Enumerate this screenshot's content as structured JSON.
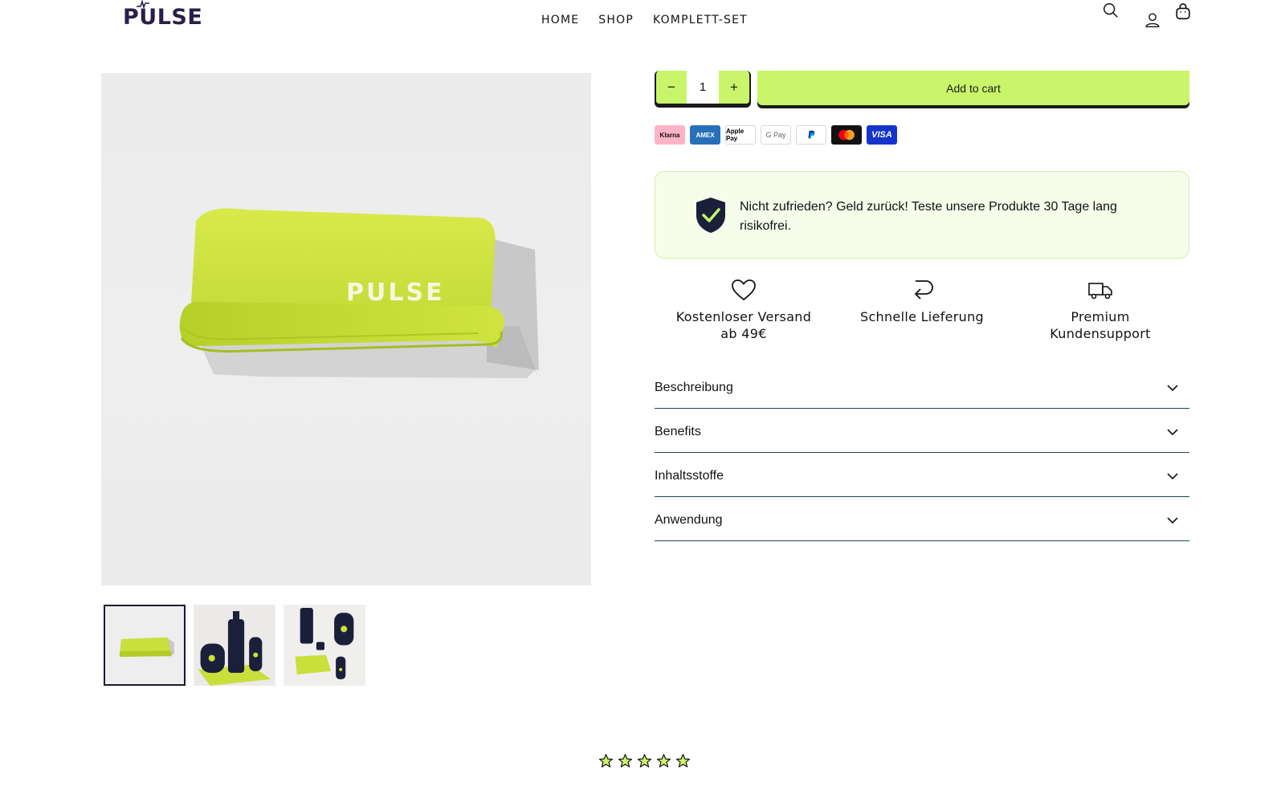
{
  "header": {
    "logo": "PULSE",
    "nav": [
      "HOME",
      "SHOP",
      "KOMPLETT-SET"
    ],
    "icons": [
      "search-icon",
      "account-icon",
      "cart-icon"
    ]
  },
  "product": {
    "image_brand_text": "PULSE",
    "thumbnails": [
      "band",
      "bottle-set",
      "full-set"
    ]
  },
  "buy": {
    "quantity": "1",
    "minus": "−",
    "plus": "+",
    "add_to_cart": "Add to cart"
  },
  "payments": [
    "Klarna",
    "AMEX",
    "Apple Pay",
    "G Pay",
    "PayPal",
    "Mastercard",
    "VISA"
  ],
  "guarantee": {
    "text": "Nicht zufrieden? Geld zurück! Teste unsere Produkte 30 Tage lang risikofrei."
  },
  "features": [
    {
      "icon": "heart-icon",
      "label": "Kostenloser Versand\nab 49€"
    },
    {
      "icon": "return-arrow-icon",
      "label": "Schnelle Lieferung"
    },
    {
      "icon": "truck-icon",
      "label": "Premium\nKundensupport"
    }
  ],
  "accordion": [
    "Beschreibung",
    "Benefits",
    "Inhaltsstoffe",
    "Anwendung"
  ],
  "rating": {
    "stars": 5
  },
  "colors": {
    "accent": "#c8f56a",
    "navy": "#1a1f3a",
    "guarantee_bg": "#f6fdea",
    "divider": "#1e4a4a"
  }
}
